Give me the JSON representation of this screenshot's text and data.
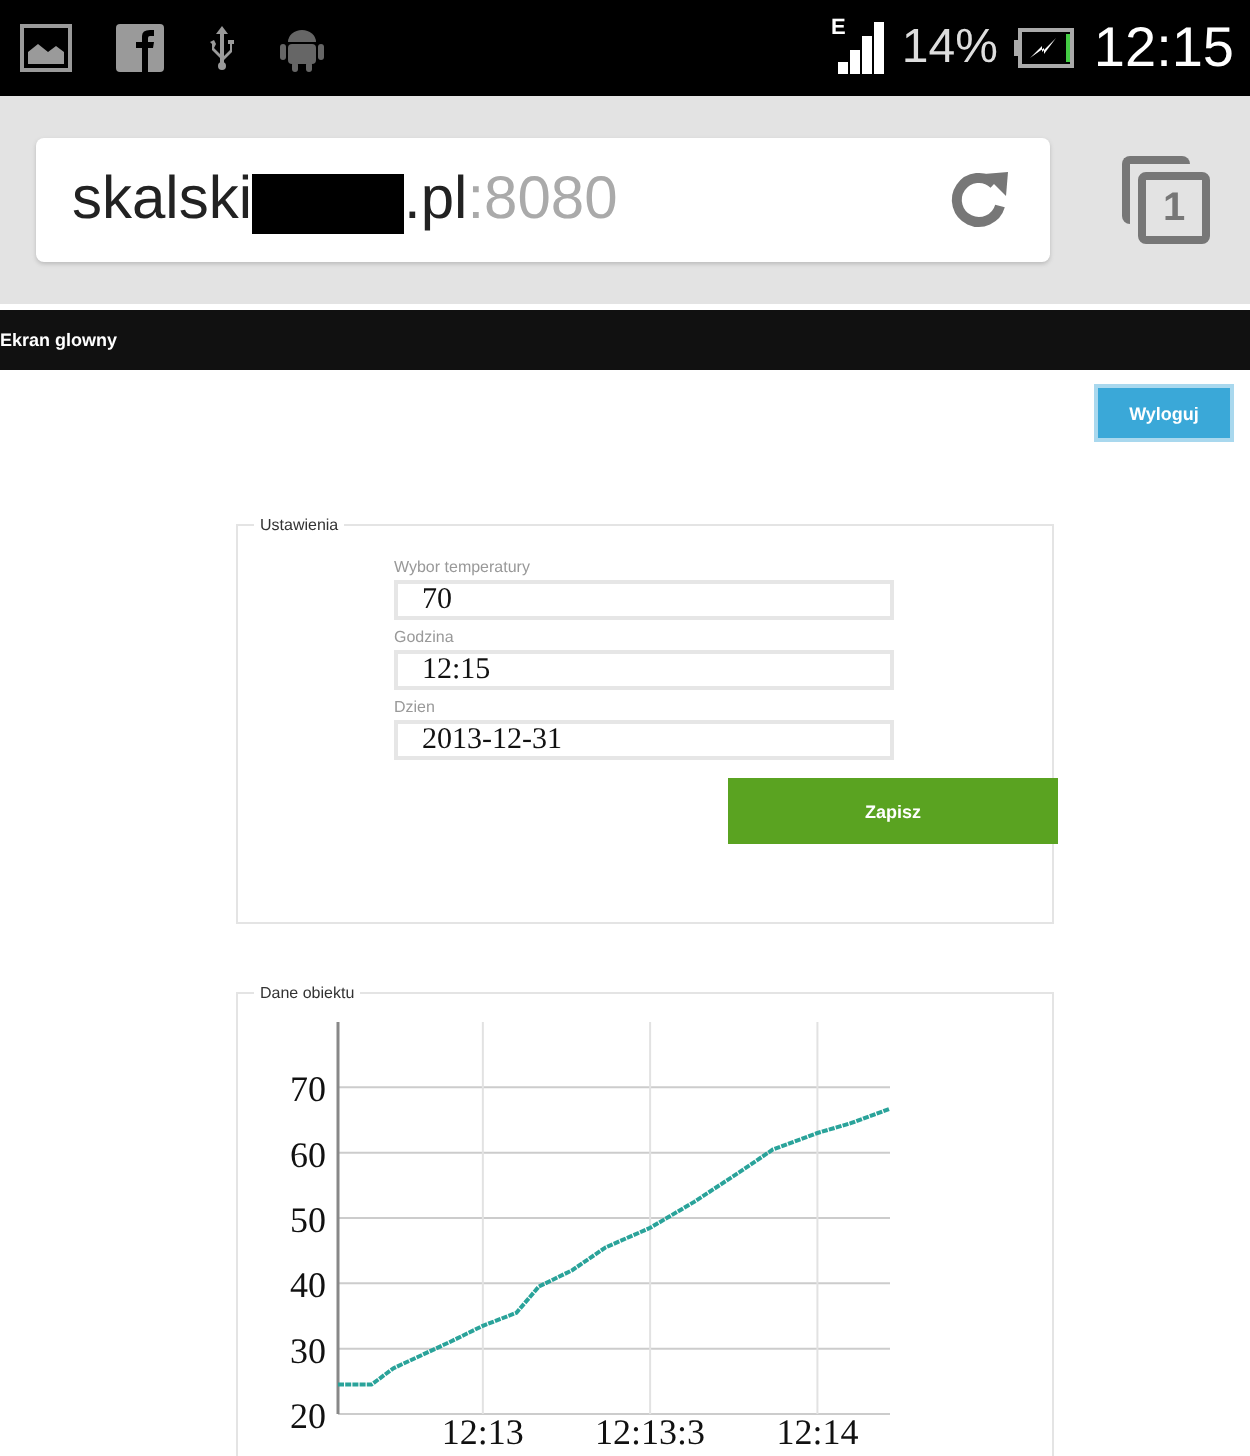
{
  "status_bar": {
    "network": "E",
    "battery": "14%",
    "time": "12:15"
  },
  "address_bar": {
    "host_start": "skalski",
    "host_end": ".pl",
    "port": ":8080",
    "tab_count": "1"
  },
  "nav_bar": {
    "title": "Ekran glowny"
  },
  "logout_button": "Wyloguj",
  "settings": {
    "legend": "Ustawienia",
    "fields": [
      {
        "label": "Wybor temperatury",
        "value": "70"
      },
      {
        "label": "Godzina",
        "value": "12:15"
      },
      {
        "label": "Dzien",
        "value": "2013-12-31"
      }
    ],
    "save_button": "Zapisz"
  },
  "object_data": {
    "legend": "Dane obiektu",
    "chart_data": {
      "type": "line",
      "x": [
        732.567,
        732.667,
        732.733,
        732.9,
        733,
        733.1,
        733.167,
        733.267,
        733.367,
        733.5,
        733.633,
        733.767,
        733.867,
        734,
        734.1,
        734.217
      ],
      "grid": true,
      "series": [
        {
          "color": "#2aa39a",
          "line_style": "dotted",
          "values": [
            24.5,
            24.5,
            27,
            31,
            33.5,
            35.5,
            39.5,
            42,
            45.5,
            48.5,
            52.5,
            57,
            60.5,
            63,
            64.5,
            66.7
          ]
        }
      ],
      "xlim": [
        732.567,
        734.217
      ],
      "ylim": [
        20,
        80
      ],
      "xticks": [
        {
          "value": 733,
          "label": "12:13"
        },
        {
          "value": 733.5,
          "label": "12:13:3"
        },
        {
          "value": 734,
          "label": "12:14"
        }
      ],
      "yticks": [
        20,
        30,
        40,
        50,
        60,
        70
      ]
    }
  }
}
